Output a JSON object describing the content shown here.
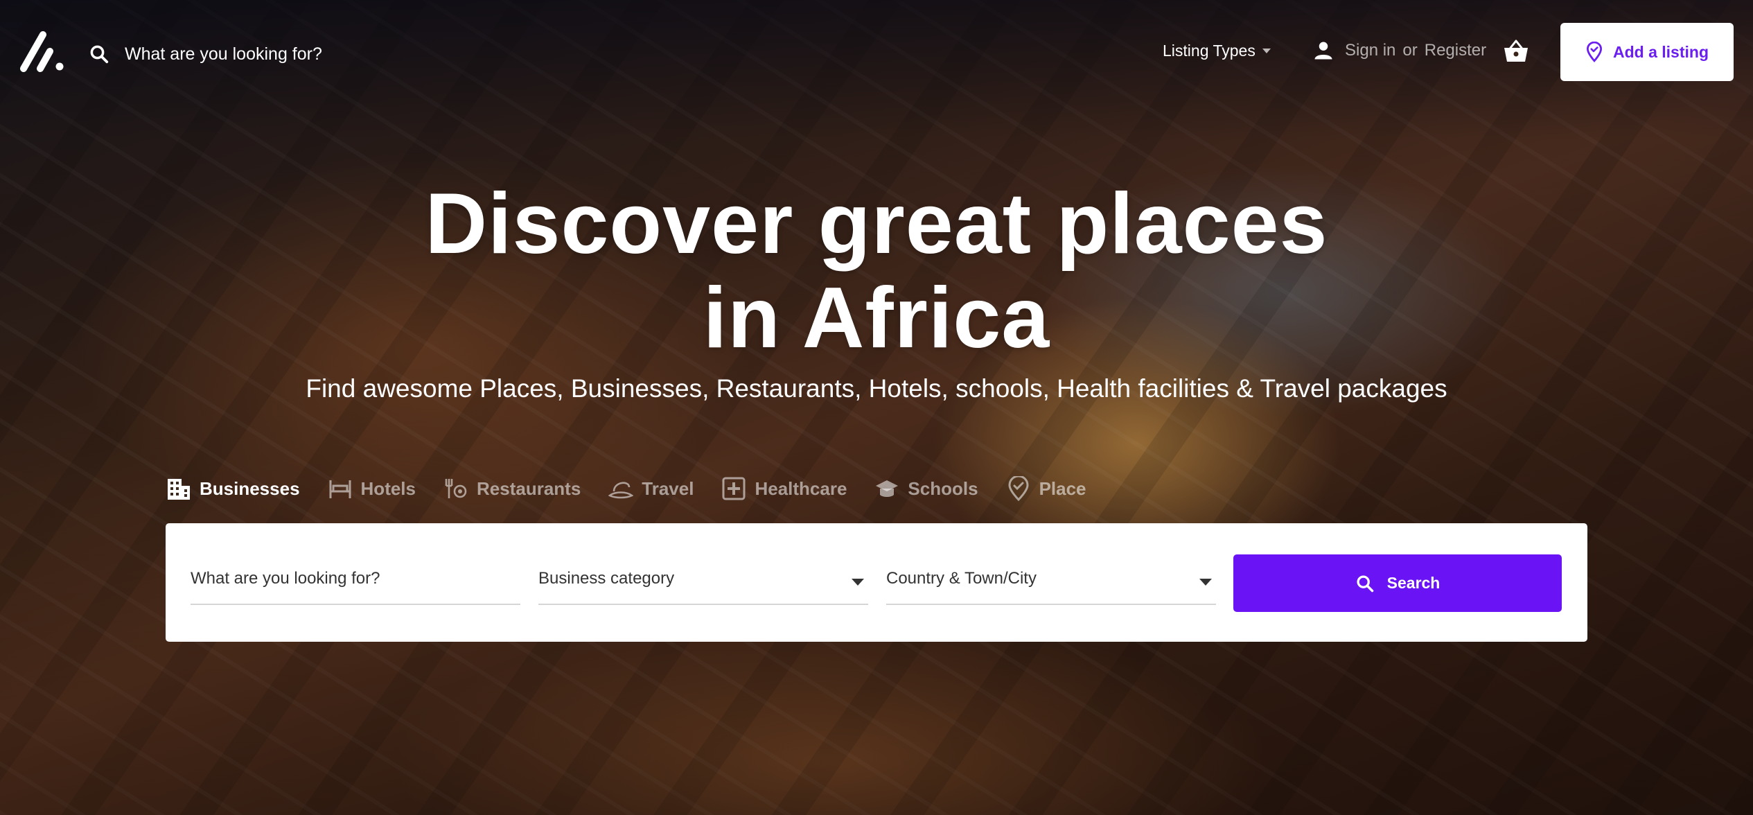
{
  "header": {
    "search_text": "What are you looking for?",
    "listing_types": "Listing Types",
    "signin_label": "Sign in",
    "or_label": "or",
    "register_label": "Register",
    "add_listing": "Add a listing"
  },
  "hero": {
    "title_line1": "Discover great places",
    "title_line2": "in Africa",
    "subtitle": "Find awesome Places, Businesses, Restaurants, Hotels, schools, Health facilities & Travel packages"
  },
  "tabs": [
    {
      "label": "Businesses",
      "icon": "building-icon",
      "active": true
    },
    {
      "label": "Hotels",
      "icon": "bed-icon",
      "active": false
    },
    {
      "label": "Restaurants",
      "icon": "utensils-icon",
      "active": false
    },
    {
      "label": "Travel",
      "icon": "hat-icon",
      "active": false
    },
    {
      "label": "Healthcare",
      "icon": "medical-cross-icon",
      "active": false
    },
    {
      "label": "Schools",
      "icon": "graduation-cap-icon",
      "active": false
    },
    {
      "label": "Place",
      "icon": "map-pin-icon",
      "active": false
    }
  ],
  "search": {
    "keyword_placeholder": "What are you looking for?",
    "category_value": "Business category",
    "location_value": "Country & Town/City",
    "button_label": "Search"
  },
  "colors": {
    "accent": "#6a14f5",
    "add_listing_text": "#6b1ef0"
  }
}
